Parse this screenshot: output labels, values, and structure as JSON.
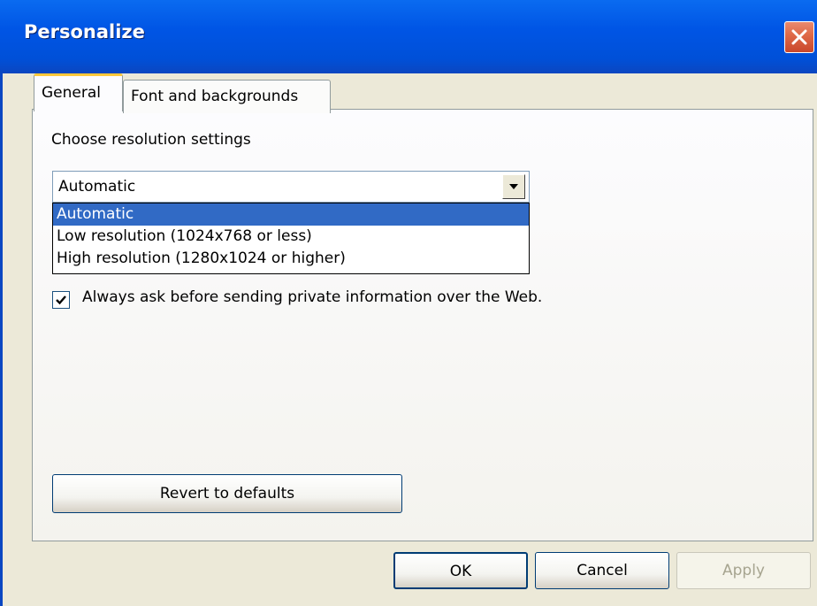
{
  "window": {
    "title": "Personalize"
  },
  "tabs": [
    {
      "label": "General",
      "active": true
    },
    {
      "label": "Font and backgrounds",
      "active": false
    }
  ],
  "resolution": {
    "section_label": "Choose resolution settings",
    "selected": "Automatic",
    "options": [
      "Automatic",
      "Low resolution (1024x768 or less)",
      "High resolution (1280x1024 or higher)"
    ],
    "dropdown_open": true
  },
  "privacy": {
    "checkbox_label": "Always ask before sending private information over the Web.",
    "checked": true
  },
  "buttons": {
    "revert": "Revert to defaults",
    "ok": "OK",
    "cancel": "Cancel",
    "apply": "Apply"
  },
  "colors": {
    "titlebar": "#0055e5",
    "selection": "#316ac5",
    "tab_highlight": "#ffc83c",
    "close_button": "#e06b4a"
  },
  "icons": {
    "close": "close-icon",
    "dropdown": "chevron-down-icon",
    "check": "check-icon"
  }
}
